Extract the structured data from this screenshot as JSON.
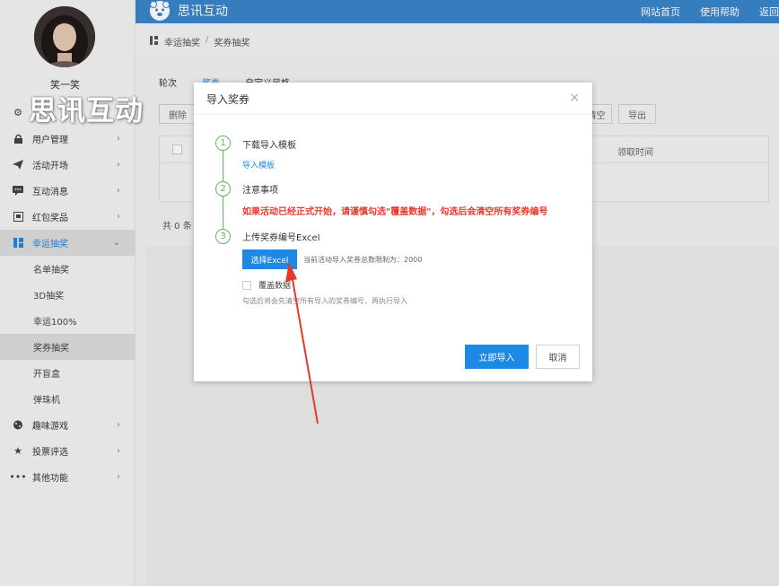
{
  "watermark": "思讯互动",
  "user": {
    "name": "笑一笑"
  },
  "header": {
    "brand": "思讯互动",
    "links": [
      "网站首页",
      "使用帮助",
      "返回"
    ]
  },
  "sidebar": {
    "items": [
      {
        "label": "",
        "icon": "gear-icon"
      },
      {
        "label": "用户管理",
        "icon": "lock-icon"
      },
      {
        "label": "活动开场",
        "icon": "send-icon"
      },
      {
        "label": "互动消息",
        "icon": "message-icon"
      },
      {
        "label": "红包奖品",
        "icon": "gift-icon"
      },
      {
        "label": "幸运抽奖",
        "icon": "grid-icon",
        "active": true
      },
      {
        "label": "趣味游戏",
        "icon": "gamepad-icon"
      },
      {
        "label": "投票评选",
        "icon": "star-icon"
      },
      {
        "label": "其他功能",
        "icon": "more-icon"
      }
    ],
    "sub_items": [
      "名单抽奖",
      "3D抽奖",
      "幸运100%",
      "奖券抽奖",
      "开盲盒",
      "弹珠机"
    ]
  },
  "breadcrumb": {
    "parent": "幸运抽奖",
    "sep": "/",
    "current": "奖券抽奖"
  },
  "page": {
    "tabs": [
      "轮次",
      "奖券",
      "自定义风格"
    ],
    "delete_label": "删除",
    "clear_label": "清空",
    "export_label": "导出",
    "column_time": "领取时间",
    "total": "共 0 条"
  },
  "modal": {
    "title": "导入奖券",
    "close": "×",
    "steps": [
      {
        "num": "1",
        "title": "下载导入模板",
        "link": "导入模板"
      },
      {
        "num": "2",
        "title": "注意事项",
        "warning": "如果活动已经正式开始，请谨慎勾选\"覆盖数据\"，勾选后会清空所有奖券编号"
      },
      {
        "num": "3",
        "title": "上传奖券编号Excel"
      }
    ],
    "excel_button": "选择Excel",
    "limit_text": "当前活动导入奖券总数限制为：2000",
    "overwrite_label": "覆盖数据",
    "hint": "勾选后将会先清空所有导入的奖券编号，再执行导入",
    "import_button": "立即导入",
    "cancel_button": "取消"
  }
}
